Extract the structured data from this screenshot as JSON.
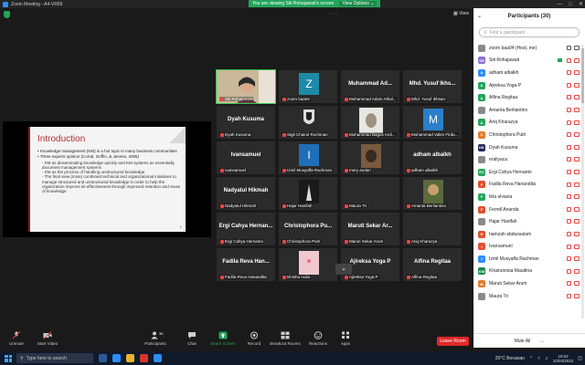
{
  "window": {
    "title": "Zoom Meeting - A4-VR65",
    "share_banner": "You are viewing Siti Rohajawati's screen",
    "view_options": "View Options ⌄"
  },
  "top": {
    "view_label": "View"
  },
  "slide": {
    "title": "Introduction",
    "bullets": [
      "Knowledge management (KM) is a hot topic in many business communities",
      "Three experts opinion (Corral, Griffin, & Jennex, 2005)"
    ],
    "sub_bullets": [
      "KM as disseminating knowledge quickly and KM systems as essentially document management systems",
      "KM as the process of handling unstructured knowledge",
      "The final view (mine) combined technical and organizational initiatives to manage structured and unstructured knowledge in order to help the organization improve its effectiveness through improved retention and reuse of knowledge"
    ],
    "page": "1"
  },
  "gallery": {
    "tiles": [
      {
        "big": "",
        "name": "Siti Rohajawati",
        "kind": "photo",
        "active": true
      },
      {
        "big": "",
        "name": "zoom baa04",
        "kind": "avatar",
        "avatar": "Z",
        "avatar_color": "#1e8aa8"
      },
      {
        "big": "Muhammad Ad...",
        "name": "Muhammad Adam Athal...",
        "kind": "name"
      },
      {
        "big": "Mhd. Yusuf Ikhs...",
        "name": "Mhd. Yusuf Ikhsan",
        "kind": "name"
      },
      {
        "big": "Dyah Kusuma",
        "name": "Dyah Kusuma",
        "kind": "name"
      },
      {
        "big": "",
        "name": "Sigit Chairul Rochman",
        "kind": "logo"
      },
      {
        "big": "",
        "name": "Muhammad Bagus Ardi...",
        "kind": "photo2"
      },
      {
        "big": "",
        "name": "Muhammad Valen Firda...",
        "kind": "avatar",
        "avatar": "M",
        "avatar_color": "#2c7fc9"
      },
      {
        "big": "Ivansamuel",
        "name": "Ivansamuel",
        "kind": "name"
      },
      {
        "big": "",
        "name": "Izmil Musyaffa Rachman",
        "kind": "avatar",
        "avatar": "I",
        "avatar_color": "#1e6fb8"
      },
      {
        "big": "",
        "name": "mery andari",
        "kind": "photo3"
      },
      {
        "big": "adham albalkh",
        "name": "adham albalkh",
        "kind": "name"
      },
      {
        "big": "Nadyatul Hikmah",
        "name": "Nadyatul Hikmah",
        "kind": "name"
      },
      {
        "big": "",
        "name": "Hajar Hanifah",
        "kind": "photo4"
      },
      {
        "big": "",
        "name": "Maura Tri",
        "kind": "dark"
      },
      {
        "big": "",
        "name": "Amanta Berliantino",
        "kind": "photo5"
      },
      {
        "big": "Ergi Cahya Hernan...",
        "name": "Ergi Cahya Hernanto",
        "kind": "name"
      },
      {
        "big": "Christophora Pu...",
        "name": "Christophora Putri",
        "kind": "name"
      },
      {
        "big": "Maruti Sekar Ar...",
        "name": "Maruti Sekar Arum",
        "kind": "name"
      },
      {
        "big": "",
        "name": "Ariq Kharazya",
        "kind": "dark"
      },
      {
        "big": "Fadila Reva Han...",
        "name": "Fadila Reva Hanandita",
        "kind": "name"
      },
      {
        "big": "",
        "name": "Nhisha Aulia",
        "kind": "photo6"
      },
      {
        "big": "Ajireksa Yoga P",
        "name": "Ajireksa Yoga P",
        "kind": "name"
      },
      {
        "big": "Alfina Regitaa",
        "name": "Alfina Regitaa",
        "kind": "name"
      }
    ]
  },
  "participants": {
    "title": "Participants (30)",
    "search_placeholder": "Find a participant",
    "list": [
      {
        "initials": "",
        "name": "zoom baa04 (Host, me)",
        "color": "#1e8aa8",
        "video": false
      },
      {
        "initials": "SR",
        "name": "Siti Rohajawati",
        "color": "#8a6fd1",
        "video": true
      },
      {
        "initials": "A",
        "name": "adham albalkh",
        "color": "#2d8cff",
        "video": false
      },
      {
        "initials": "A",
        "name": "Ajireksa Yoga P",
        "color": "#23a559",
        "video": false
      },
      {
        "initials": "A",
        "name": "Alfina Regitaa",
        "color": "#23a559",
        "video": false
      },
      {
        "initials": "",
        "name": "Amanta Berliantino",
        "color": "#6b6b6b",
        "video": false
      },
      {
        "initials": "A",
        "name": "Ariq Kharazya",
        "color": "#23a559",
        "video": false
      },
      {
        "initials": "C",
        "name": "Christophora Putri",
        "color": "#e47a2e",
        "video": false
      },
      {
        "initials": "DK",
        "name": "Dyah Kusuma",
        "color": "#1e2a5a",
        "video": false
      },
      {
        "initials": "",
        "name": "eraliyaca",
        "color": "#6b6b6b",
        "video": false
      },
      {
        "initials": "EC",
        "name": "Ergi Cahya Hernanto",
        "color": "#23a559",
        "video": false
      },
      {
        "initials": "F",
        "name": "Fadila Reva Hanandita",
        "color": "#e0502f",
        "video": false
      },
      {
        "initials": "F",
        "name": "fela elviana",
        "color": "#23a559",
        "video": false
      },
      {
        "initials": "F",
        "name": "Ferrell Ananda",
        "color": "#e0502f",
        "video": false
      },
      {
        "initials": "",
        "name": "Hajar Hanifah",
        "color": "#6b6b6b",
        "video": false
      },
      {
        "initials": "H",
        "name": "hamzah abdussalam",
        "color": "#e0502f",
        "video": false
      },
      {
        "initials": "I",
        "name": "Ivansamuel",
        "color": "#e0502f",
        "video": false
      },
      {
        "initials": "I",
        "name": "Izmil Musyaffa Rachman",
        "color": "#2d8cff",
        "video": false
      },
      {
        "initials": "KM",
        "name": "Khairunnisa Maudina",
        "color": "#1e8a4a",
        "video": false
      },
      {
        "initials": "M",
        "name": "Maruti Sekar Arum",
        "color": "#e47a2e",
        "video": false
      },
      {
        "initials": "",
        "name": "Maura Tri",
        "color": "#6b6b6b",
        "video": false
      }
    ],
    "mute_all": "Mute All",
    "more": "..."
  },
  "toolbar": {
    "unmute": "Unmute",
    "start_video": "Start Video",
    "participants": "Participants",
    "participants_count": "30",
    "chat": "Chat",
    "share_screen": "Share Screen",
    "record": "Record",
    "breakout": "Breakout Rooms",
    "reactions": "Reactions",
    "apps": "Apps",
    "leave": "Leave Room"
  },
  "taskbar": {
    "search_placeholder": "Type here to search",
    "weather": "25°C Berawan",
    "time": "19:02",
    "date": "10/03/2022"
  },
  "colors": {
    "accent": "#2d8cff",
    "leave": "#e02828",
    "active_border": "#39c552",
    "share_green": "#23a559"
  }
}
